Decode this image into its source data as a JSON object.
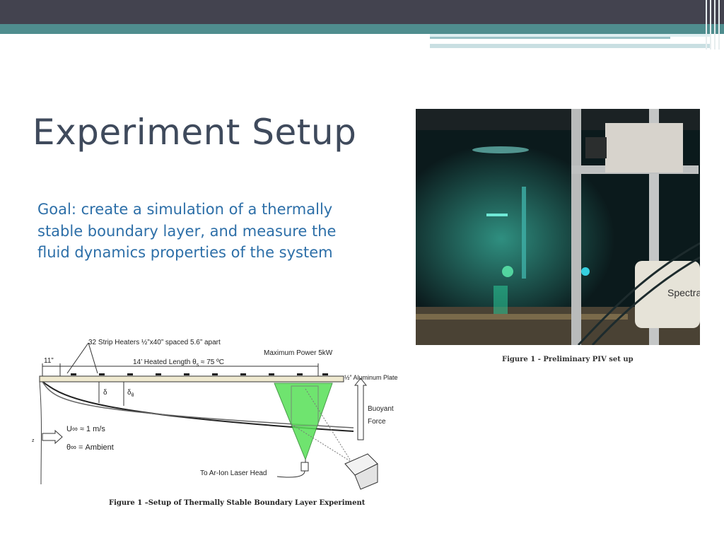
{
  "slide": {
    "title": "Experiment Setup",
    "body": "Goal: create a simulation of a thermally stable boundary layer, and measure the fluid dynamics properties of the system",
    "colors": {
      "header_dark": "#43434f",
      "header_teal": "#4f8d8e",
      "title": "#3f4a5c",
      "body": "#2d6fa8"
    }
  },
  "photo": {
    "caption": "Figure 1 - Preliminary PIV set up",
    "device_label": "Spectra"
  },
  "diagram": {
    "strip_heaters": "32 Strip Heaters ½”x40” spaced 5.6” apart",
    "max_power": "Maximum Power 5kW",
    "dim_11": "11”",
    "heated_length": "14’ Heated Length θ",
    "heated_length_sub": "s",
    "heated_length_tail": " ≈ 75 ºC",
    "plate": "½” Aluminum Plate",
    "delta": "δ",
    "delta_theta": "δ",
    "delta_theta_sub": "θ",
    "u_inf": "U∞ ≈ 1 m/s",
    "theta_inf": "θ∞ = Ambient",
    "z_label": "z",
    "buoyant": "Buoyant",
    "force": "Force",
    "laser": "To Ar-Ion Laser Head",
    "caption": "Figure 1 –Setup of Thermally Stable Boundary Layer Experiment"
  }
}
